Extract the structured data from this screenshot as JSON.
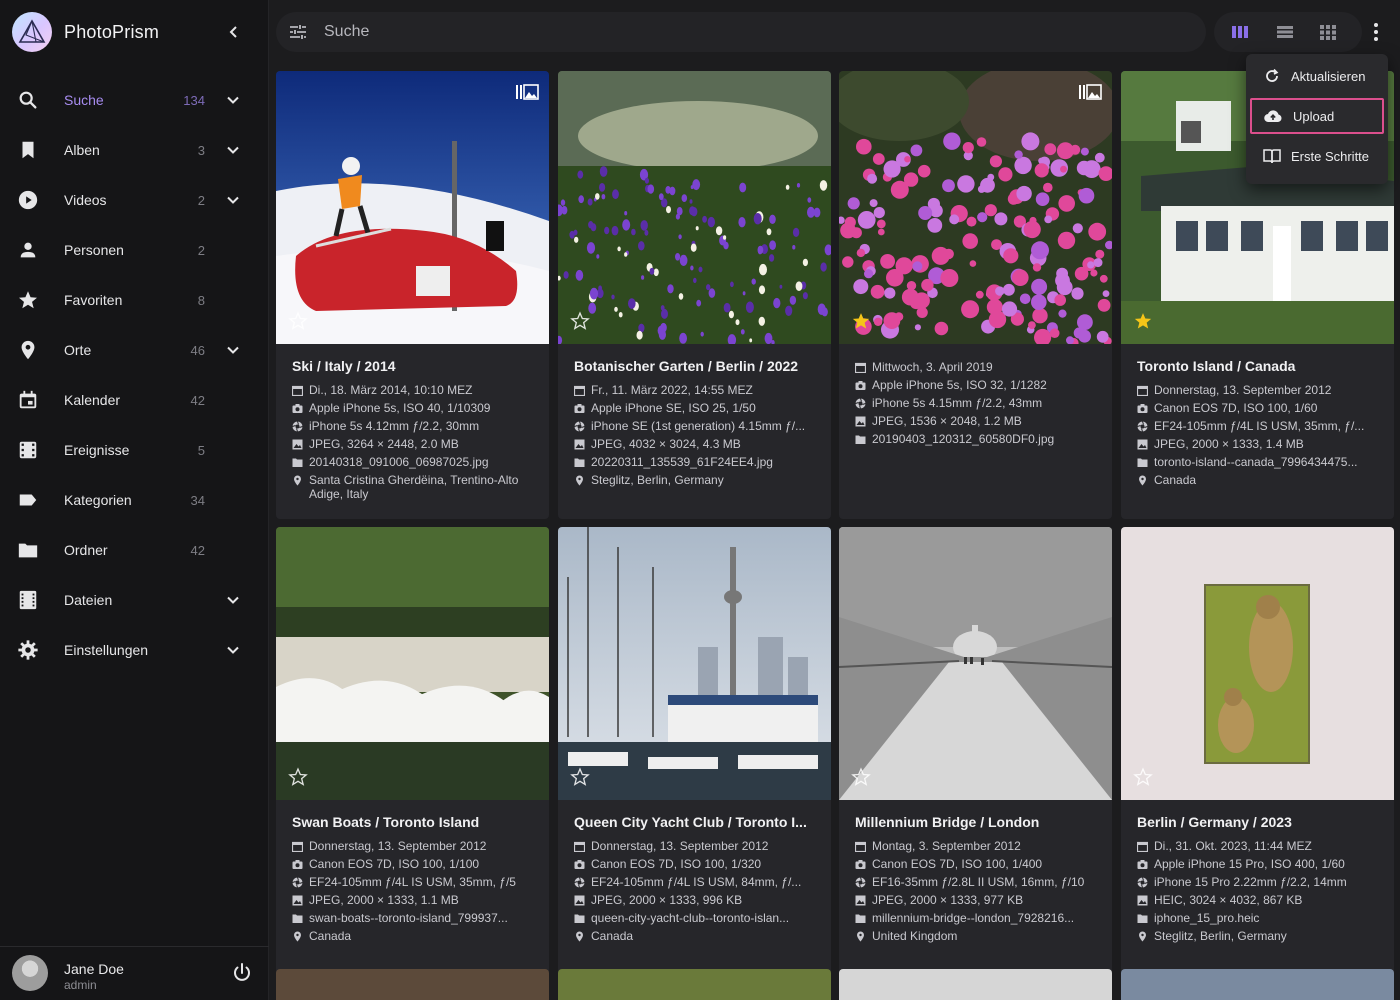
{
  "app": {
    "title": "PhotoPrism"
  },
  "sidebar": {
    "items": [
      {
        "label": "Suche",
        "count": "134",
        "icon": "search-icon",
        "expandable": true,
        "active": true
      },
      {
        "label": "Alben",
        "count": "3",
        "icon": "bookmark-icon",
        "expandable": true
      },
      {
        "label": "Videos",
        "count": "2",
        "icon": "play-icon",
        "expandable": true
      },
      {
        "label": "Personen",
        "count": "2",
        "icon": "person-icon",
        "expandable": false
      },
      {
        "label": "Favoriten",
        "count": "8",
        "icon": "star-icon",
        "expandable": false
      },
      {
        "label": "Orte",
        "count": "46",
        "icon": "map-pin-icon",
        "expandable": true
      },
      {
        "label": "Kalender",
        "count": "42",
        "icon": "calendar-icon",
        "expandable": false
      },
      {
        "label": "Ereignisse",
        "count": "5",
        "icon": "film-icon",
        "expandable": false
      },
      {
        "label": "Kategorien",
        "count": "34",
        "icon": "label-icon",
        "expandable": false
      },
      {
        "label": "Ordner",
        "count": "42",
        "icon": "folder-icon",
        "expandable": false
      },
      {
        "label": "Dateien",
        "count": "",
        "icon": "files-icon",
        "expandable": true
      },
      {
        "label": "Einstellungen",
        "count": "",
        "icon": "gear-icon",
        "expandable": true
      }
    ]
  },
  "user": {
    "name": "Jane Doe",
    "role": "admin"
  },
  "topbar": {
    "search_placeholder": "Suche"
  },
  "menu": {
    "items": [
      {
        "label": "Aktualisieren",
        "icon": "refresh-icon"
      },
      {
        "label": "Upload",
        "icon": "cloud-upload-icon"
      },
      {
        "label": "Erste Schritte",
        "icon": "book-open-icon"
      }
    ]
  },
  "colors": {
    "accent": "#a78cf0",
    "favorite": "#f5c518",
    "highlight": "#dc4f8d"
  },
  "photos": [
    {
      "title": "Ski / Italy / 2014",
      "date": "Di., 18. März 2014, 10:10 MEZ",
      "camera": "Apple iPhone 5s, ISO 40, 1/10309",
      "lens": "iPhone 5s 4.12mm ƒ/2.2, 30mm",
      "file_info": "JPEG, 3264 × 2448, 2.0 MB",
      "file_name": "20140318_091006_06987025.jpg",
      "location": "Santa Cristina Gherdëina, Trentino-Alto Adige, Italy",
      "favorite": false
    },
    {
      "title": "Botanischer Garten / Berlin / 2022",
      "date": "Fr., 11. März 2022, 14:55 MEZ",
      "camera": "Apple iPhone SE, ISO 25, 1/50",
      "lens": "iPhone SE (1st generation) 4.15mm ƒ/...",
      "file_info": "JPEG, 4032 × 3024, 4.3 MB",
      "file_name": "20220311_135539_61F24EE4.jpg",
      "location": "Steglitz, Berlin, Germany",
      "favorite": false
    },
    {
      "title": "",
      "date": "Mittwoch, 3. April 2019",
      "camera": "Apple iPhone 5s, ISO 32, 1/1282",
      "lens": "iPhone 5s 4.15mm ƒ/2.2, 43mm",
      "file_info": "JPEG, 1536 × 2048, 1.2 MB",
      "file_name": "20190403_120312_60580DF0.jpg",
      "location": "",
      "favorite": true
    },
    {
      "title": "Toronto Island / Canada",
      "date": "Donnerstag, 13. September 2012",
      "camera": "Canon EOS 7D, ISO 100, 1/60",
      "lens": "EF24-105mm ƒ/4L IS USM, 35mm, ƒ/...",
      "file_info": "JPEG, 2000 × 1333, 1.4 MB",
      "file_name": "toronto-island--canada_7996434475...",
      "location": "Canada",
      "favorite": true
    },
    {
      "title": "Swan Boats / Toronto Island",
      "date": "Donnerstag, 13. September 2012",
      "camera": "Canon EOS 7D, ISO 100, 1/100",
      "lens": "EF24-105mm ƒ/4L IS USM, 35mm, ƒ/5",
      "file_info": "JPEG, 2000 × 1333, 1.1 MB",
      "file_name": "swan-boats--toronto-island_799937...",
      "location": "Canada",
      "favorite": false
    },
    {
      "title": "Queen City Yacht Club / Toronto I...",
      "date": "Donnerstag, 13. September 2012",
      "camera": "Canon EOS 7D, ISO 100, 1/320",
      "lens": "EF24-105mm ƒ/4L IS USM, 84mm, ƒ/...",
      "file_info": "JPEG, 2000 × 1333, 996 KB",
      "file_name": "queen-city-yacht-club--toronto-islan...",
      "location": "Canada",
      "favorite": false
    },
    {
      "title": "Millennium Bridge / London",
      "date": "Montag, 3. September 2012",
      "camera": "Canon EOS 7D, ISO 100, 1/400",
      "lens": "EF16-35mm ƒ/2.8L II USM, 16mm, ƒ/10",
      "file_info": "JPEG, 2000 × 1333, 977 KB",
      "file_name": "millennium-bridge--london_7928216...",
      "location": "United Kingdom",
      "favorite": false
    },
    {
      "title": "Berlin / Germany / 2023",
      "date": "Di., 31. Okt. 2023, 11:44 MEZ",
      "camera": "Apple iPhone 15 Pro, ISO 400, 1/60",
      "lens": "iPhone 15 Pro 2.22mm ƒ/2.2, 14mm",
      "file_info": "HEIC, 3024 × 4032, 867 KB",
      "file_name": "iphone_15_pro.heic",
      "location": "Steglitz, Berlin, Germany",
      "favorite": false
    }
  ]
}
